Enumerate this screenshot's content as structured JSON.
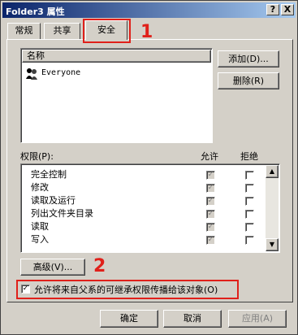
{
  "window": {
    "title": "Folder3 属性",
    "help_button": "?",
    "close_button": "X"
  },
  "tabs": [
    {
      "label": "常规"
    },
    {
      "label": "共享"
    },
    {
      "label": "安全"
    }
  ],
  "annotations": {
    "label_1": "1",
    "label_2": "2",
    "color": "#e0201a"
  },
  "users": {
    "header": "名称",
    "items": [
      {
        "name": "Everyone",
        "icon": "users-group-icon"
      }
    ]
  },
  "buttons": {
    "add": "添加(D)...",
    "remove": "删除(R)",
    "advanced": "高级(V)...",
    "ok": "确定",
    "cancel": "取消",
    "apply": "应用(A)"
  },
  "permissions": {
    "header_label": "权限(P):",
    "allow_header": "允许",
    "deny_header": "拒绝",
    "rows": [
      {
        "name": "完全控制",
        "allow": true,
        "deny": false
      },
      {
        "name": "修改",
        "allow": true,
        "deny": false
      },
      {
        "name": "读取及运行",
        "allow": true,
        "deny": false
      },
      {
        "name": "列出文件夹目录",
        "allow": true,
        "deny": false
      },
      {
        "name": "读取",
        "allow": true,
        "deny": false
      },
      {
        "name": "写入",
        "allow": true,
        "deny": false
      }
    ]
  },
  "inherit": {
    "checked": true,
    "label": "允许将来自父系的可继承权限传播给该对象(O)"
  }
}
